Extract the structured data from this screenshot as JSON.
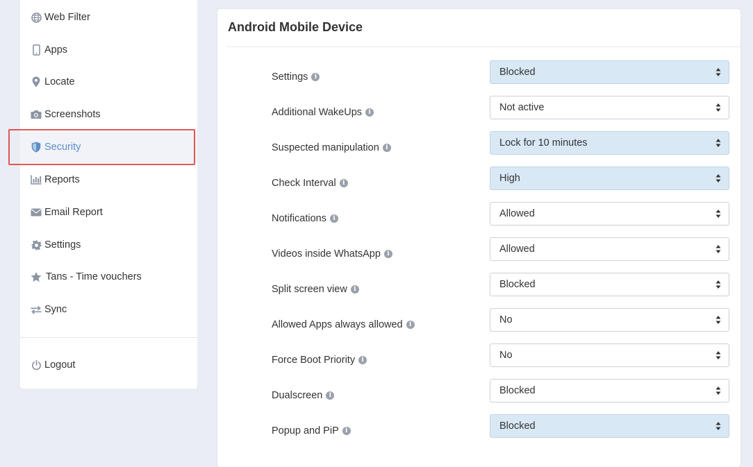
{
  "sidebar": {
    "items": [
      {
        "label": "Web Filter",
        "icon": "globe-icon"
      },
      {
        "label": "Apps",
        "icon": "mobile-icon"
      },
      {
        "label": "Locate",
        "icon": "map-pin-icon"
      },
      {
        "label": "Screenshots",
        "icon": "camera-icon"
      },
      {
        "label": "Security",
        "icon": "shield-icon",
        "active": true
      },
      {
        "label": "Reports",
        "icon": "bar-chart-icon"
      },
      {
        "label": "Email Report",
        "icon": "envelope-icon"
      },
      {
        "label": "Settings",
        "icon": "gear-icon"
      },
      {
        "label": "Tans - Time vouchers",
        "icon": "star-icon"
      },
      {
        "label": "Sync",
        "icon": "sync-arrows-icon"
      }
    ],
    "logout": {
      "label": "Logout",
      "icon": "power-icon"
    }
  },
  "panel": {
    "title": "Android Mobile Device",
    "settings": [
      {
        "label": "Settings",
        "value": "Blocked",
        "tinted": true
      },
      {
        "label": "Additional WakeUps",
        "value": "Not active",
        "tinted": false
      },
      {
        "label": "Suspected manipulation",
        "value": "Lock for 10 minutes",
        "tinted": true
      },
      {
        "label": "Check Interval",
        "value": "High",
        "tinted": true
      },
      {
        "label": "Notifications",
        "value": "Allowed",
        "tinted": false
      },
      {
        "label": "Videos inside WhatsApp",
        "value": "Allowed",
        "tinted": false
      },
      {
        "label": "Split screen view",
        "value": "Blocked",
        "tinted": false
      },
      {
        "label": "Allowed Apps always allowed",
        "value": "No",
        "tinted": false
      },
      {
        "label": "Force Boot Priority",
        "value": "No",
        "tinted": false
      },
      {
        "label": "Dualscreen",
        "value": "Blocked",
        "tinted": false
      },
      {
        "label": "Popup and PiP",
        "value": "Blocked",
        "tinted": true
      }
    ]
  },
  "colors": {
    "accent": "#5b8fc7",
    "highlight": "#e25555",
    "tinted_select": "#d9e8f5",
    "page_bg": "#eaedf4"
  }
}
